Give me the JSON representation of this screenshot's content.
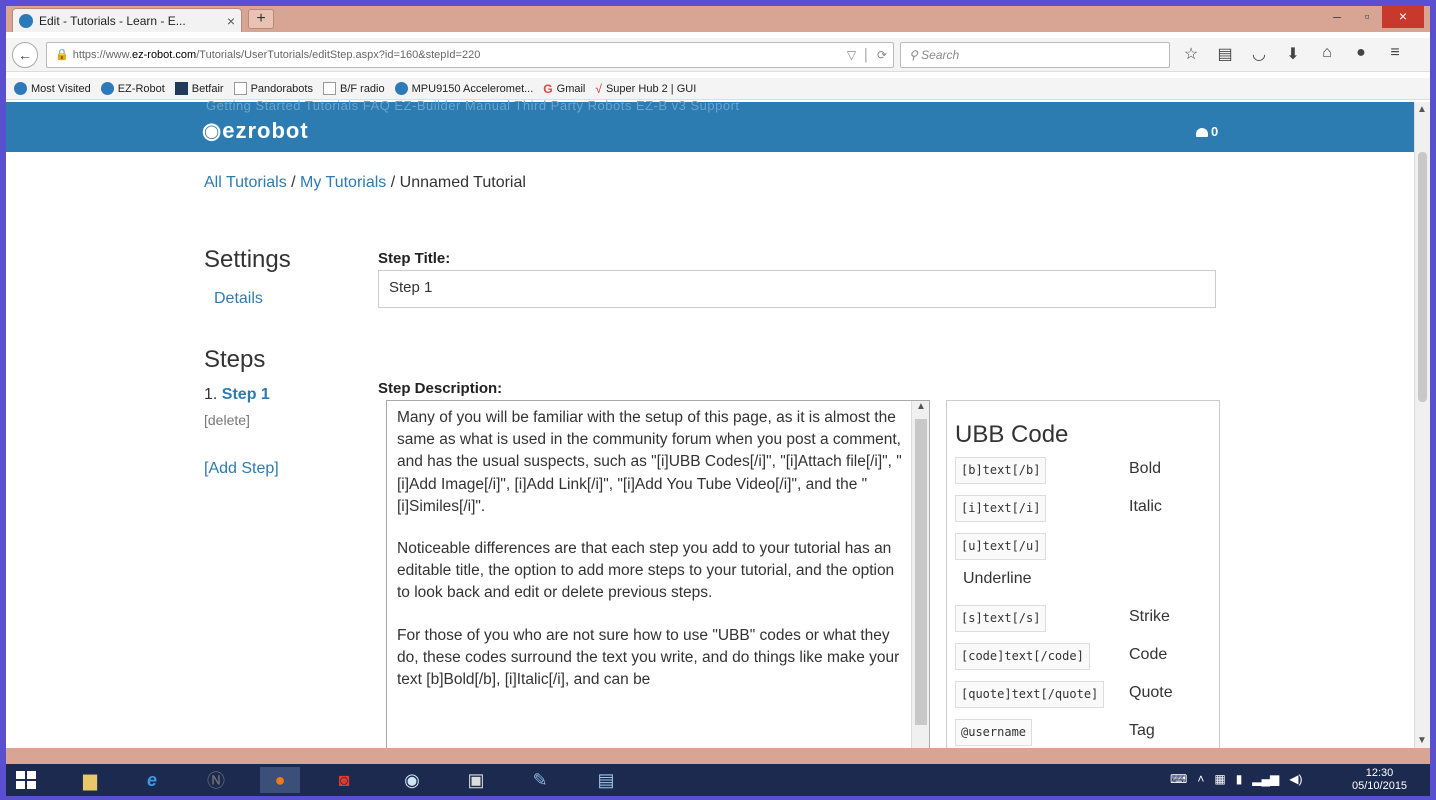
{
  "browser": {
    "tab_title": "Edit - Tutorials - Learn - E...",
    "tab_close": "×",
    "new_tab": "+",
    "url_prefix": "https://www.",
    "url_domain": "ez-robot.com",
    "url_path": "/Tutorials/UserTutorials/editStep.aspx?id=160&stepId=220",
    "search_placeholder": "Search",
    "window_min": "–",
    "window_max": "▫",
    "window_close": "×"
  },
  "bookmarks": [
    {
      "label": "Most Visited",
      "icon": "most-visited-icon"
    },
    {
      "label": "EZ-Robot",
      "icon": "ez-robot-icon"
    },
    {
      "label": "Betfair",
      "icon": "betfair-icon"
    },
    {
      "label": "Pandorabots",
      "icon": "page-icon"
    },
    {
      "label": "B/F radio",
      "icon": "page-icon"
    },
    {
      "label": "MPU9150 Acceleromet...",
      "icon": "ez-robot-icon"
    },
    {
      "label": "Gmail",
      "icon": "google-icon"
    },
    {
      "label": "Super Hub 2 | GUI",
      "icon": "check-icon"
    }
  ],
  "site": {
    "logo": "ezrobot",
    "menu_ghost": "Getting Started      Tutorials      FAQ      EZ-Builder Manual      Third Party Robots      EZ-B v3 Support",
    "cart_count": "0"
  },
  "breadcrumb": {
    "all": "All Tutorials",
    "sep1": " / ",
    "mine": "My Tutorials",
    "sep2": " / ",
    "current": "Unnamed Tutorial"
  },
  "sidebar": {
    "settings_heading": "Settings",
    "details_link": "Details",
    "steps_heading": "Steps",
    "step_number": "1.",
    "step_label": "Step 1",
    "delete_link": "[delete]",
    "add_step": "[Add Step]"
  },
  "form": {
    "step_title_label": "Step Title:",
    "step_title_value": "Step 1",
    "step_description_label": "Step Description:",
    "description_paragraphs": [
      "Many of you will be familiar with the setup of this page, as it is almost the same as what is used in the community forum when you post a comment, and has the usual suspects, such as \"[i]UBB Codes[/i]\", \"[i]Attach file[/i]\", \"[i]Add Image[/i]\", [i]Add Link[/i]\", \"[i]Add You Tube Video[/i]\",  and the \"[i]Similes[/i]\".",
      "Noticeable differences are that each step you add to your tutorial has an editable title, the option to add more steps to your tutorial, and the option to look back and edit or delete previous steps.",
      "For those of you who are not sure how to use \"UBB\" codes or what they do, these codes surround the text you write, and do things like make your text [b]Bold[/b], [i]Italic[/i], and can be"
    ]
  },
  "ubb": {
    "title": "UBB Code",
    "rows": [
      {
        "code": "[b]text[/b]",
        "name": "Bold"
      },
      {
        "code": "[i]text[/i]",
        "name": "Italic"
      },
      {
        "code": "[u]text[/u]",
        "name": "Underline"
      },
      {
        "code": "[s]text[/s]",
        "name": "Strike"
      },
      {
        "code": "[code]text[/code]",
        "name": "Code"
      },
      {
        "code": "[quote]text[/quote]",
        "name": "Quote"
      },
      {
        "code": "@username",
        "name": "Tag"
      }
    ]
  },
  "taskbar": {
    "time": "12:30",
    "date": "05/10/2015"
  },
  "colors": {
    "brand_blue": "#2c7bb1",
    "tab_bar": "#d8a594",
    "taskbar": "#1b2a4e",
    "window_border": "#5a4fcf"
  }
}
